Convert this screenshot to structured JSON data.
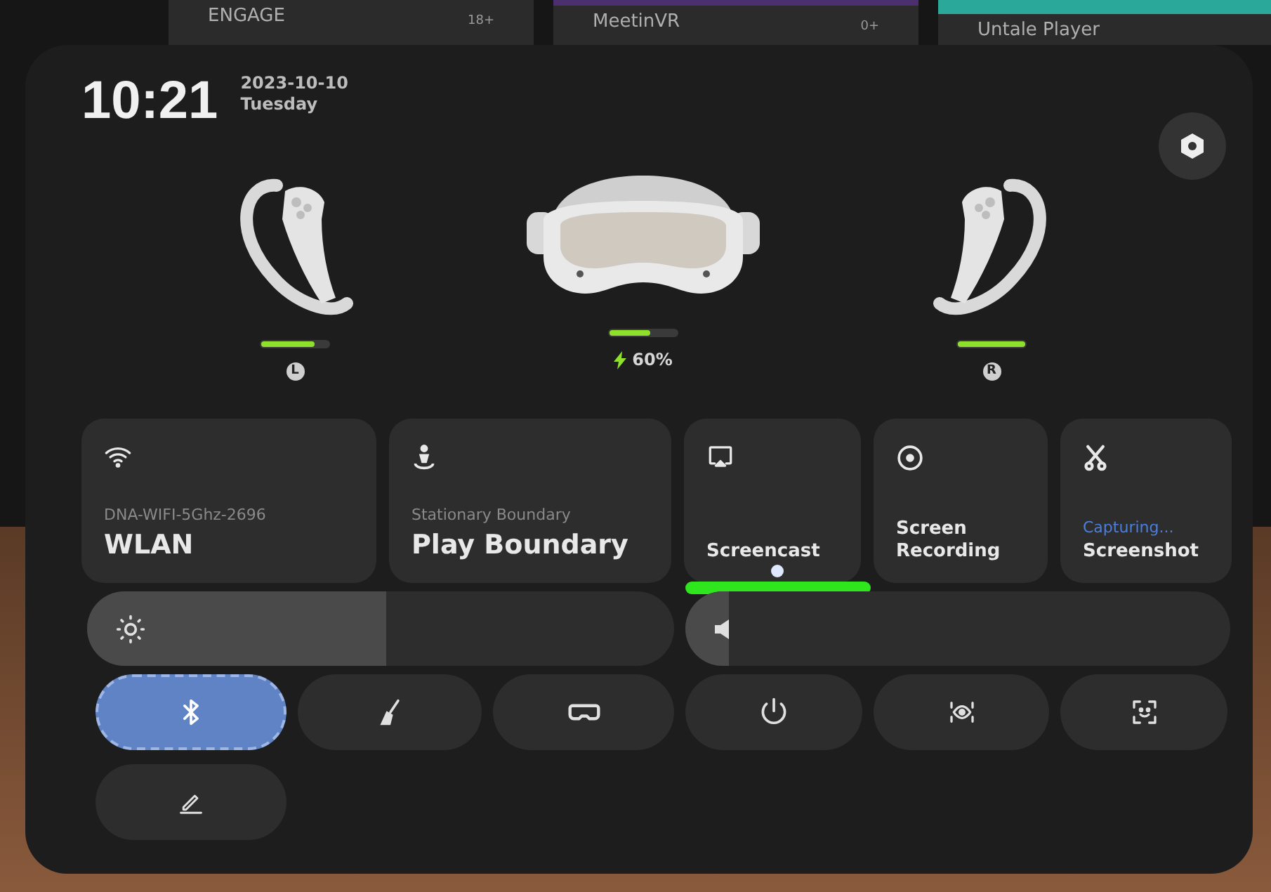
{
  "background_apps": [
    {
      "title": "ENGAGE",
      "rating": "18+"
    },
    {
      "title": "MeetinVR",
      "rating": "0+"
    },
    {
      "title": "Untale Player"
    }
  ],
  "header": {
    "time": "10:21",
    "date": "2023-10-10",
    "weekday": "Tuesday"
  },
  "devices": [
    {
      "kind": "left-controller",
      "level": 0.8,
      "badge": "L"
    },
    {
      "kind": "headset",
      "level": 0.6,
      "charging": true,
      "reading": "60%"
    },
    {
      "kind": "right-controller",
      "level": 1.0,
      "badge": "R"
    }
  ],
  "tiles": [
    {
      "kind": "wifi",
      "subtitle": "DNA-WIFI-5Ghz-2696",
      "label": "WLAN"
    },
    {
      "kind": "boundary",
      "subtitle": "Stationary Boundary",
      "label": "Play Boundary"
    },
    {
      "kind": "screencast",
      "label": "Screencast"
    },
    {
      "kind": "record",
      "label": "Screen Recording"
    },
    {
      "kind": "screenshot",
      "status": "Capturing...",
      "label": "Screenshot"
    }
  ],
  "sliders": [
    {
      "kind": "brightness",
      "level": 0.51
    },
    {
      "kind": "volume",
      "level": 0.08
    }
  ],
  "quick_buttons": [
    {
      "kind": "bluetooth",
      "on": true
    },
    {
      "kind": "clean",
      "on": false
    },
    {
      "kind": "vr",
      "on": false
    },
    {
      "kind": "power",
      "on": false
    },
    {
      "kind": "eye",
      "on": false
    },
    {
      "kind": "face",
      "on": false
    },
    {
      "kind": "edit",
      "on": false
    }
  ]
}
